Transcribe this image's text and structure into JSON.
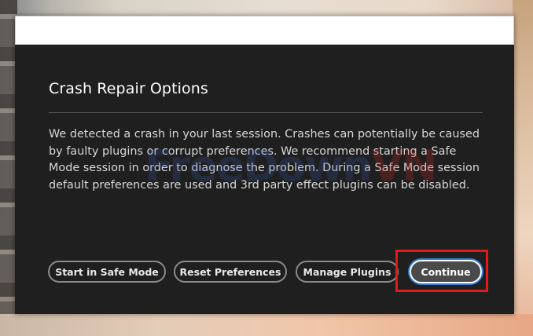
{
  "dialog": {
    "title": "Crash Repair Options",
    "message": "We detected a crash in your last session. Crashes can potentially be caused by faulty plugins or corrupt preferences. We recommend starting a Safe Mode session in order to diagnose the problem. During a Safe Mode session default preferences are used and 3rd party effect plugins can be disabled.",
    "buttons": {
      "safe_mode": "Start in Safe Mode",
      "reset_prefs": "Reset Preferences",
      "manage_plugins": "Manage Plugins",
      "continue": "Continue"
    }
  },
  "watermark": {
    "part1": "FreeDown",
    "part2": "VN"
  },
  "colors": {
    "dialog_bg": "#1f1f1f",
    "highlight": "#e21a1a",
    "focus_ring": "#2f7fd8"
  }
}
